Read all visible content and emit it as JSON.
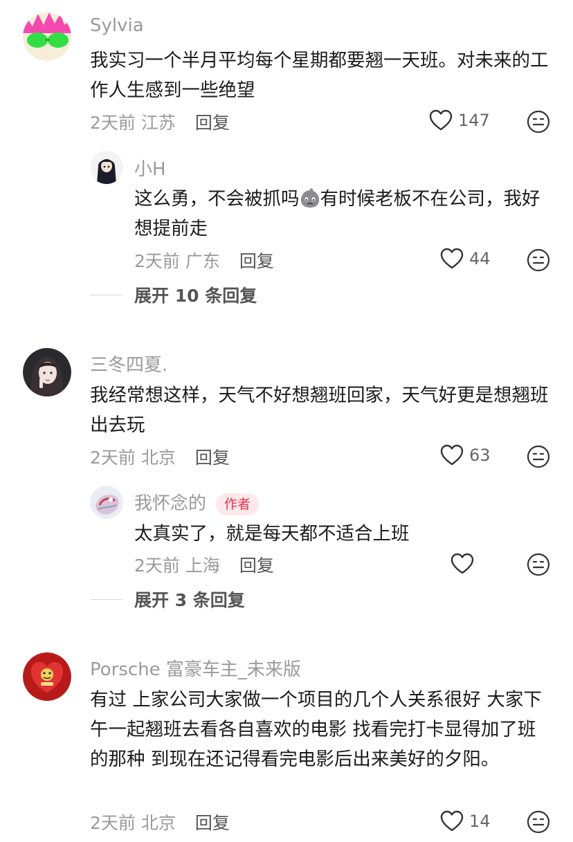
{
  "comments": [
    {
      "user": "Sylvia",
      "text": "我实习一个半月平均每个星期都要翘一天班。对未来的工作人生感到一些绝望",
      "time": "2天前",
      "location": "江苏",
      "reply_label": "回复",
      "likes": "147",
      "replies": [
        {
          "user": "小H",
          "text_before": "这么勇，不会被抓吗",
          "inline_emoji": "blob-sweat-emoji",
          "text_after": "有时候老板不在公司，我好想提前走",
          "time": "2天前",
          "location": "广东",
          "reply_label": "回复",
          "likes": "44"
        }
      ],
      "expand_label": "展开 10 条回复"
    },
    {
      "user": "三冬四夏.",
      "text": "我经常想这样，天气不好想翘班回家，天气好更是想翘班出去玩",
      "time": "2天前",
      "location": "北京",
      "reply_label": "回复",
      "likes": "63",
      "replies": [
        {
          "user": "我怀念的",
          "badge": "作者",
          "text": "太真实了，就是每天都不适合上班",
          "time": "2天前",
          "location": "上海",
          "reply_label": "回复",
          "likes": ""
        }
      ],
      "expand_label": "展开 3 条回复"
    },
    {
      "user": "Porsche 富豪车主_未来版",
      "text": "有过 上家公司大家做一个项目的几个人关系很好 大家下午一起翘班去看各自喜欢的电影 找看完打卡显得加了班的那种 到现在还记得看完电影后出来美好的夕阳。",
      "time": "2天前",
      "location": "北京",
      "reply_label": "回复",
      "likes": "14"
    }
  ],
  "colors": {
    "meta": "#9a9a9a",
    "author_badge_bg": "#fde8eb",
    "author_badge_text": "#e8324f"
  }
}
